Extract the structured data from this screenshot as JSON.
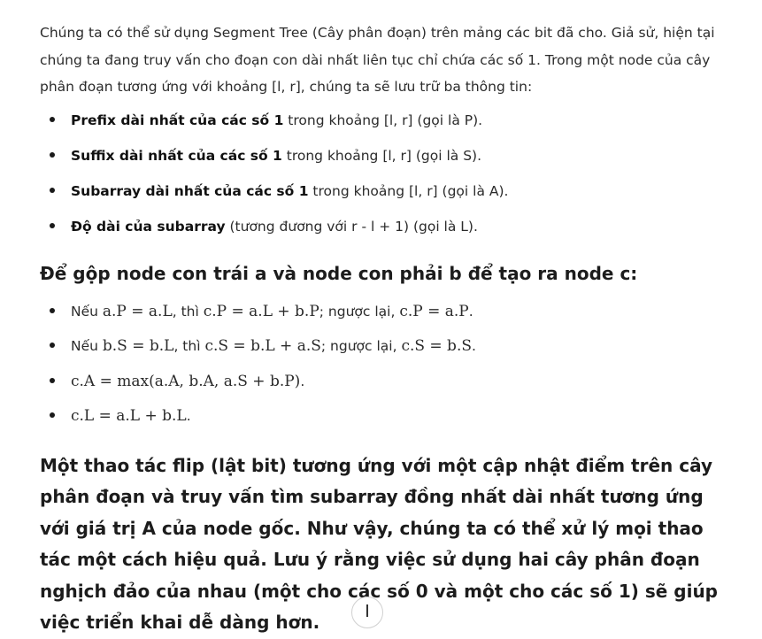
{
  "intro": "Chúng ta có thể sử dụng Segment Tree (Cây phân đoạn) trên mảng các bit đã cho. Giả sử, hiện tại chúng ta đang truy vấn cho đoạn con dài nhất liên tục chỉ chứa các số 1. Trong một node của cây phân đoạn tương ứng với khoảng [l, r], chúng ta sẽ lưu trữ ba thông tin:",
  "properties": [
    {
      "bold": "Prefix dài nhất của các số 1",
      "rest": " trong khoảng [l, r] (gọi là P)."
    },
    {
      "bold": "Suffix dài nhất của các số 1",
      "rest": " trong khoảng [l, r] (gọi là S)."
    },
    {
      "bold": "Subarray dài nhất của các số 1",
      "rest": " trong khoảng [l, r] (gọi là A)."
    },
    {
      "bold": "Độ dài của subarray",
      "rest": " (tương đương với r - l + 1) (gọi là L)."
    }
  ],
  "merge_heading": "Để gộp node con trái a và node con phải b để tạo ra node c:",
  "rules": {
    "r1": {
      "neu": "Nếu ",
      "cond": "a.P = a.L",
      "then": ", thì ",
      "assign": "c.P = a.L + b.P",
      "else": "; ngược lại, ",
      "alt": "c.P = a.P",
      "end": "."
    },
    "r2": {
      "neu": "Nếu ",
      "cond": "b.S = b.L",
      "then": ", thì ",
      "assign": "c.S = b.L + a.S",
      "else": "; ngược lại, ",
      "alt": "c.S = b.S",
      "end": "."
    },
    "r3": {
      "formula": "c.A = max(a.A, b.A, a.S + b.P)",
      "end": "."
    },
    "r4": {
      "formula": "c.L = a.L + b.L",
      "end": "."
    }
  },
  "conclusion": {
    "before": "Một thao tác flip (lật bit) tương ứng với một cập nhật điểm trên cây phân đoạn và truy vấn tìm subarray đồng nhất dài nhất tương ứng với giá trị ",
    "strong": "A",
    "after": " của node gốc. Như vậy, chúng ta có thể xử lý mọi thao tác một cách hiệu quả. Lưu ý rằng việc sử dụng hai cây phân đoạn nghịch đảo của nhau (một cho các số 0 và một cho các số 1) sẽ giúp việc triển khai dễ dàng hơn."
  },
  "icons": {
    "scroll": "arrow-down-icon"
  }
}
